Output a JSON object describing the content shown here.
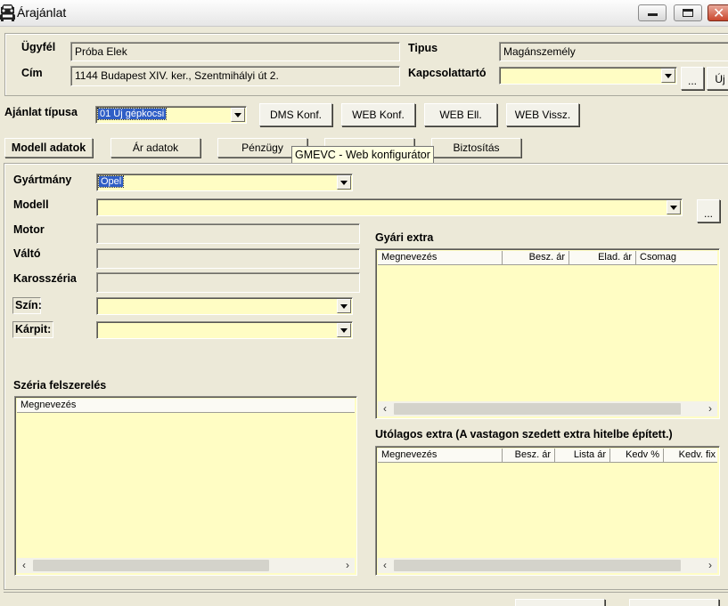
{
  "window": {
    "title": "Árajánlat"
  },
  "customer": {
    "client_label": "Ügyfél",
    "client_value": "Próba Elek",
    "address_label": "Cím",
    "address_value": "1144 Budapest XIV. ker., Szentmihályi út 2.",
    "type_label": "Tipus",
    "type_value": "Magánszemély",
    "contact_label": "Kapcsolattartó",
    "contact_value": "",
    "browse_label": "...",
    "new_label": "Új"
  },
  "offer": {
    "type_label": "Ajánlat típusa",
    "type_value": "01 Új gépkocsi",
    "buttons": [
      "DMS Konf.",
      "WEB Konf.",
      "WEB Ell.",
      "WEB Vissz."
    ]
  },
  "tabs": [
    {
      "label": "Modell adatok",
      "active": true
    },
    {
      "label": "Ár adatok"
    },
    {
      "label": "Pénzügy"
    },
    {
      "label": ""
    },
    {
      "label": "Biztosítás"
    }
  ],
  "tooltip": "GMEVC - Web konfigurátor",
  "model": {
    "make_label": "Gyártmány",
    "make_value": "Opel",
    "model_label": "Modell",
    "model_value": "",
    "model_browse": "...",
    "engine_label": "Motor",
    "gearbox_label": "Váltó",
    "body_label": "Karosszéria",
    "color_label": "Szín:",
    "upholstery_label": "Kárpit:"
  },
  "standard_equipment": {
    "title": "Széria felszerelés",
    "columns": [
      "Megnevezés"
    ]
  },
  "factory_extra": {
    "title": "Gyári extra",
    "columns": [
      "Megnevezés",
      "Besz. ár",
      "Elad. ár",
      "Csomag"
    ]
  },
  "aftermarket_extra": {
    "title": "Utólagos extra (A vastagon szedett extra hitelbe épített.)",
    "columns": [
      "Megnevezés",
      "Besz. ár",
      "Lista ár",
      "Kedv %",
      "Kedv. fix"
    ]
  },
  "colors": {
    "input_bg": "#fffdc4",
    "window_bg": "#ece9d8",
    "selection": "#2f5ec6"
  }
}
